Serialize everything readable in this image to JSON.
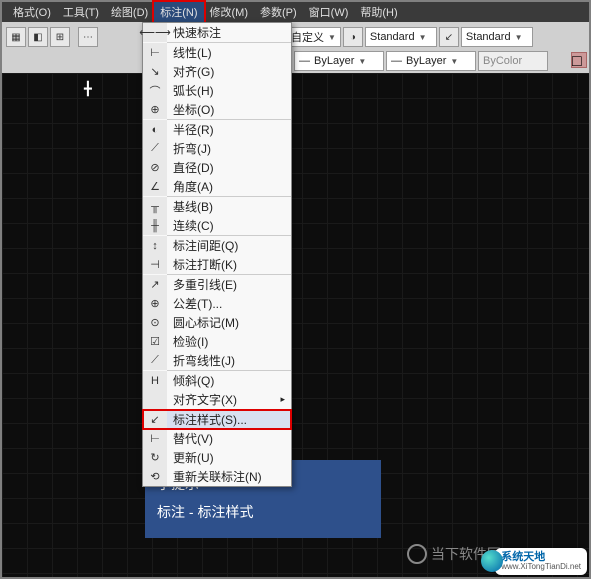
{
  "menubar": {
    "items": [
      "格式(O)",
      "工具(T)",
      "绘图(D)",
      "标注(N)",
      "修改(M)",
      "参数(P)",
      "窗口(W)",
      "帮助(H)"
    ],
    "active_index": 3
  },
  "toolbar": {
    "custom_label": "自定义",
    "standard1": "Standard",
    "standard2": "Standard",
    "bylayer1": "ByLayer",
    "bylayer2": "ByLayer",
    "bycolor": "ByColor"
  },
  "dropdown": {
    "items": [
      {
        "icon": "⟵⟶",
        "label": "快速标注"
      },
      {
        "sep": true
      },
      {
        "icon": "⊢",
        "label": "线性(L)"
      },
      {
        "icon": "↘",
        "label": "对齐(G)"
      },
      {
        "icon": "⌒",
        "label": "弧长(H)"
      },
      {
        "icon": "⊕",
        "label": "坐标(O)"
      },
      {
        "sep": true
      },
      {
        "icon": "◐",
        "label": "半径(R)"
      },
      {
        "icon": "⟋",
        "label": "折弯(J)"
      },
      {
        "icon": "⊘",
        "label": "直径(D)"
      },
      {
        "icon": "∠",
        "label": "角度(A)"
      },
      {
        "sep": true
      },
      {
        "icon": "╥",
        "label": "基线(B)"
      },
      {
        "icon": "╫",
        "label": "连续(C)"
      },
      {
        "sep": true
      },
      {
        "icon": "↕",
        "label": "标注间距(Q)"
      },
      {
        "icon": "⊣",
        "label": "标注打断(K)"
      },
      {
        "sep": true
      },
      {
        "icon": "↗",
        "label": "多重引线(E)"
      },
      {
        "icon": "⊕",
        "label": "公差(T)..."
      },
      {
        "icon": "⊙",
        "label": "圆心标记(M)"
      },
      {
        "icon": "☑",
        "label": "检验(I)"
      },
      {
        "icon": "⟋",
        "label": "折弯线性(J)"
      },
      {
        "sep": true
      },
      {
        "icon": "H",
        "label": "倾斜(Q)"
      },
      {
        "icon": "",
        "label": "对齐文字(X)",
        "arrow": true
      },
      {
        "sep": true
      },
      {
        "icon": "↙",
        "label": "标注样式(S)...",
        "highlight": true
      },
      {
        "icon": "⊢",
        "label": "替代(V)"
      },
      {
        "icon": "↻",
        "label": "更新(U)"
      },
      {
        "icon": "⟲",
        "label": "重新关联标注(N)"
      }
    ]
  },
  "tooltip": {
    "title": "小提示",
    "text": "标注 - 标注样式"
  },
  "watermark": {
    "w1": "当下软件园",
    "w2_title": "系统天地",
    "w2_url": "www.XiTongTianDi.net"
  }
}
